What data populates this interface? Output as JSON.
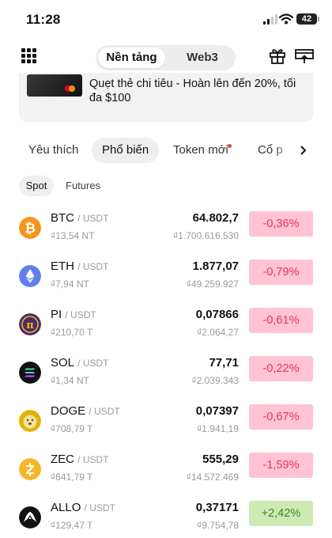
{
  "status_bar": {
    "time": "11:28",
    "battery": "42"
  },
  "header": {
    "segment_tabs": [
      "Nền tảng",
      "Web3"
    ]
  },
  "banner": {
    "text": "Quẹt thẻ chi tiêu - Hoàn lên đến 20%, tối đa $100"
  },
  "category_tabs": [
    "Yêu thích",
    "Phổ biến",
    "Token mới",
    "Cổ p"
  ],
  "market_tabs": [
    "Spot",
    "Futures"
  ],
  "colors": {
    "negative": "#e5374f",
    "negative_bg": "#ffc3d5",
    "positive": "#3b8a23",
    "positive_bg": "#cdeab5"
  },
  "coins": [
    {
      "symbol": "BTC",
      "quote": "/ USDT",
      "volume": "₫13,54 NT",
      "price": "64.802,7",
      "price_vnd": "₫1.700.616.530",
      "change": "-0,36%",
      "icon": "bitcoin-icon"
    },
    {
      "symbol": "ETH",
      "quote": "/ USDT",
      "volume": "₫7,94 NT",
      "price": "1.877,07",
      "price_vnd": "₫49.259.927",
      "change": "-0,79%",
      "icon": "ethereum-icon"
    },
    {
      "symbol": "PI",
      "quote": "/ USDT",
      "volume": "₫210,70 T",
      "price": "0,07866",
      "price_vnd": "₫2.064,27",
      "change": "-0,61%",
      "icon": "pi-network-icon"
    },
    {
      "symbol": "SOL",
      "quote": "/ USDT",
      "volume": "₫1,34 NT",
      "price": "77,71",
      "price_vnd": "₫2.039.343",
      "change": "-0,22%",
      "icon": "solana-icon"
    },
    {
      "symbol": "DOGE",
      "quote": "/ USDT",
      "volume": "₫708,79 T",
      "price": "0,07397",
      "price_vnd": "₫1.941,19",
      "change": "-0,67%",
      "icon": "dogecoin-icon"
    },
    {
      "symbol": "ZEC",
      "quote": "/ USDT",
      "volume": "₫641,79 T",
      "price": "555,29",
      "price_vnd": "₫14.572.469",
      "change": "-1,59%",
      "icon": "zcash-icon"
    },
    {
      "symbol": "ALLO",
      "quote": "/ USDT",
      "volume": "₫129,47 T",
      "price": "0,37171",
      "price_vnd": "₫9.754,78",
      "change": "+2,42%",
      "icon": "allo-icon"
    }
  ]
}
